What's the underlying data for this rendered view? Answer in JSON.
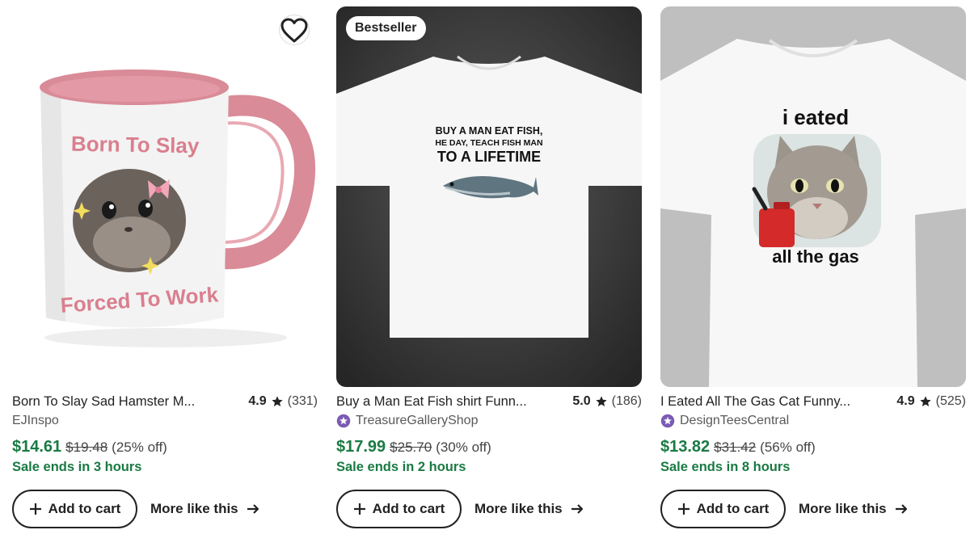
{
  "products": [
    {
      "title": "Born To Slay Sad Hamster M...",
      "rating": "4.9",
      "reviews": "(331)",
      "shop": "EJInspo",
      "star_seller": false,
      "price": "$14.61",
      "original_price": "$19.48",
      "discount": "(25% off)",
      "sale_text": "Sale ends in 3 hours",
      "image_text_top": "Born To Slay",
      "image_text_bottom": "Forced To Work",
      "badge": ""
    },
    {
      "title": "Buy a Man Eat Fish shirt Funn...",
      "rating": "5.0",
      "reviews": "(186)",
      "shop": "TreasureGalleryShop",
      "star_seller": true,
      "price": "$17.99",
      "original_price": "$25.70",
      "discount": "(30% off)",
      "sale_text": "Sale ends in 2 hours",
      "image_text_line1": "BUY A MAN EAT FISH,",
      "image_text_line2": "HE DAY, TEACH FISH MAN",
      "image_text_line3": "TO A LIFETIME",
      "badge": "Bestseller"
    },
    {
      "title": "I Eated All The Gas Cat Funny...",
      "rating": "4.9",
      "reviews": "(525)",
      "shop": "DesignTeesCentral",
      "star_seller": true,
      "price": "$13.82",
      "original_price": "$31.42",
      "discount": "(56% off)",
      "sale_text": "Sale ends in 8 hours",
      "image_text_top": "i eated",
      "image_text_bottom": "all the gas",
      "badge": ""
    }
  ],
  "actions": {
    "add_to_cart": "Add to cart",
    "more_like_this": "More like this"
  },
  "colors": {
    "sale_green": "#1a7a43",
    "mug_pink": "#d98b97",
    "star_seller_purple": "#7b5bb5"
  },
  "icons": {
    "favorite": "heart-outline-icon",
    "rating": "star-icon",
    "star_seller": "star-seller-badge-icon",
    "add": "plus-icon",
    "arrow": "arrow-right-icon"
  }
}
